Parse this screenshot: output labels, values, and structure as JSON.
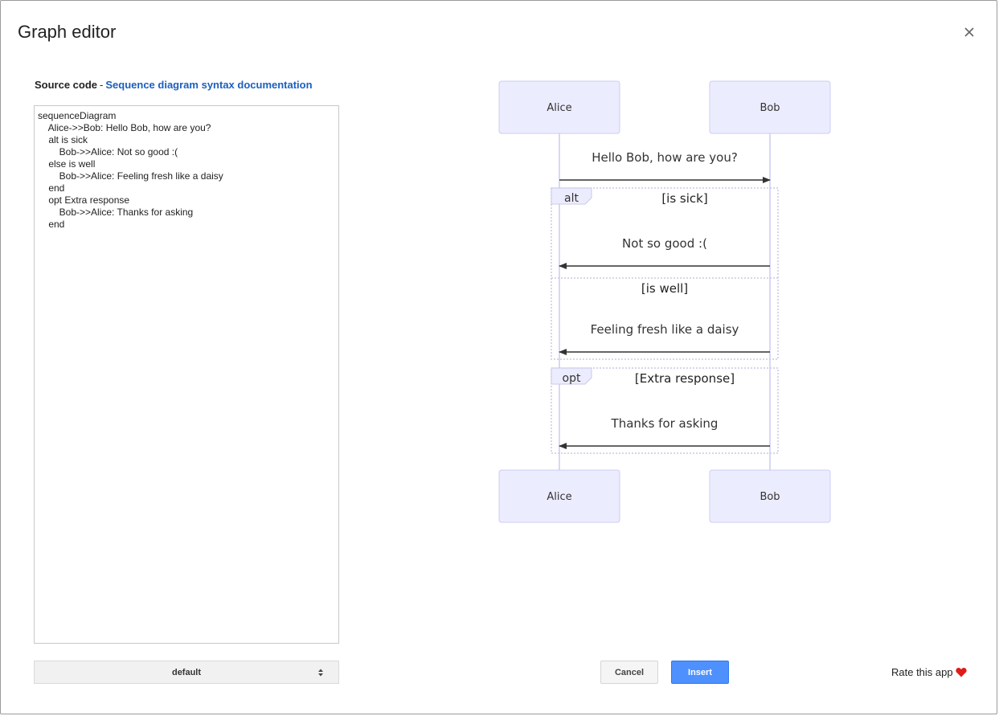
{
  "dialog": {
    "title": "Graph editor",
    "close_icon": "close-icon"
  },
  "source": {
    "label": "Source code",
    "separator": "-",
    "doc_link": "Sequence diagram syntax documentation",
    "code": "sequenceDiagram\n    Alice->>Bob: Hello Bob, how are you?\n    alt is sick\n        Bob->>Alice: Not so good :(\n    else is well\n        Bob->>Alice: Feeling fresh like a daisy\n    end\n    opt Extra response\n        Bob->>Alice: Thanks for asking\n    end"
  },
  "theme_select": {
    "value": "default",
    "icon": "select-arrows-icon"
  },
  "buttons": {
    "cancel": "Cancel",
    "insert": "Insert"
  },
  "rate": {
    "label": "Rate this app",
    "icon": "heart-icon",
    "icon_color": "#e01b1b"
  },
  "diagram": {
    "colors": {
      "actor_fill": "#ececff",
      "actor_border": "#ccccf5",
      "lifeline": "#ccccf5",
      "arrow": "#333333",
      "loop_border": "#c8c8e8"
    },
    "actors": [
      "Alice",
      "Bob"
    ],
    "messages": [
      {
        "from": "Alice",
        "to": "Bob",
        "text": "Hello Bob, how are you?"
      },
      {
        "from": "Bob",
        "to": "Alice",
        "text": "Not so good :("
      },
      {
        "from": "Bob",
        "to": "Alice",
        "text": "Feeling fresh like a daisy"
      },
      {
        "from": "Bob",
        "to": "Alice",
        "text": "Thanks for asking"
      }
    ],
    "blocks": [
      {
        "kind": "alt",
        "condition": "[is sick]",
        "else_condition": "[is well]"
      },
      {
        "kind": "opt",
        "condition": "[Extra response]"
      }
    ]
  }
}
